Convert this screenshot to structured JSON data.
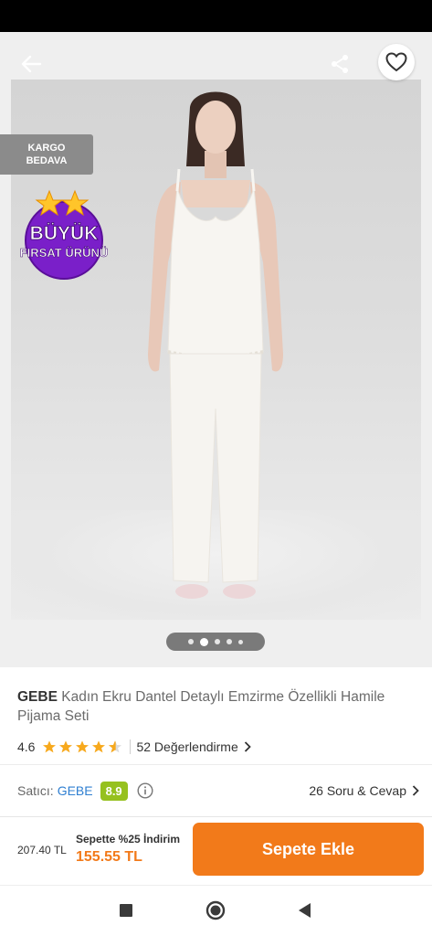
{
  "header": {
    "back_icon": "arrow-left-icon",
    "share_icon": "share-icon",
    "favorite_icon": "heart-outline-icon"
  },
  "badges": {
    "kargo_line1": "KARGO",
    "kargo_line2": "BEDAVA",
    "deal_line1": "BÜYÜK",
    "deal_line2": "FIRSAT ÜRÜNÜ"
  },
  "gallery": {
    "image_count": 5,
    "active_index": 1
  },
  "product": {
    "brand": "GEBE",
    "name": "Kadın Ekru Dantel Detaylı Emzirme Özellikli Hamile Pijama Seti"
  },
  "rating": {
    "value": "4.6",
    "stars": 4.6,
    "reviews_label": "52 Değerlendirme"
  },
  "seller": {
    "label": "Satıcı:",
    "name": "GEBE",
    "score": "8.9",
    "qa_label": "26 Soru & Cevap"
  },
  "purchase": {
    "old_price": "207.40 TL",
    "promo_label": "Sepette %25 İndirim",
    "new_price": "155.55 TL",
    "add_button_label": "Sepete Ekle"
  },
  "colors": {
    "accent": "#f27a1a",
    "star": "#f7a91d",
    "seller_score_bg": "#96c11f",
    "seller_link": "#2f7fd1",
    "deal_badge_purple": "#7a1fc9"
  }
}
